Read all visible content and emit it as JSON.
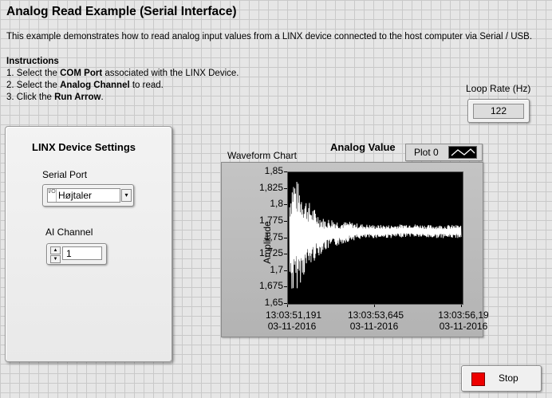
{
  "page": {
    "title": "Analog Read Example (Serial Interface)",
    "description": "This example demonstrates how to read analog input values from a LINX device connected to the host computer via Serial / USB.",
    "instructions_heading": "Instructions",
    "instructions": [
      {
        "prefix": "1. Select the ",
        "bold": "COM Port",
        "suffix": " associated with the LINX Device."
      },
      {
        "prefix": "2. Select the ",
        "bold": "Analog Channel",
        "suffix": " to read."
      },
      {
        "prefix": "3. Click the ",
        "bold": "Run Arrow",
        "suffix": "."
      }
    ]
  },
  "loop_rate": {
    "label": "Loop Rate (Hz)",
    "value": "122"
  },
  "linx_panel": {
    "title": "LINX Device Settings",
    "serial_port_label": "Serial Port",
    "serial_port_value": "Højtaler",
    "serial_port_tag": "I/O",
    "ai_channel_label": "AI Channel",
    "ai_channel_value": "1"
  },
  "chart": {
    "caption": "Waveform Chart",
    "header": "Analog Value",
    "legend": "Plot 0",
    "ylabel": "Amplitude",
    "yticks": [
      "1,85",
      "1,825",
      "1,8",
      "1,775",
      "1,75",
      "1,725",
      "1,7",
      "1,675",
      "1,65"
    ],
    "xticks": [
      {
        "time": "13:03:51,191",
        "date": "03-11-2016"
      },
      {
        "time": "13:03:53,645",
        "date": "03-11-2016"
      },
      {
        "time": "13:03:56,19",
        "date": "03-11-2016"
      }
    ]
  },
  "chart_data": {
    "type": "line",
    "title": "Analog Value",
    "ylabel": "Amplitude",
    "ylim": [
      1.65,
      1.85
    ],
    "x_range": [
      "13:03:51,191",
      "13:03:56,19"
    ],
    "series": [
      {
        "name": "Plot 0",
        "color": "#ffffff",
        "description_points": {
          "t_fraction": [
            0,
            0.02,
            0.04,
            0.06,
            0.08,
            0.1,
            0.13,
            0.16,
            0.2,
            0.25,
            0.3,
            0.35,
            0.4,
            0.5,
            0.6,
            0.7,
            0.8,
            0.9,
            1.0
          ],
          "upper": [
            1.82,
            1.85,
            1.84,
            1.83,
            1.82,
            1.81,
            1.8,
            1.79,
            1.78,
            1.78,
            1.775,
            1.775,
            1.772,
            1.77,
            1.77,
            1.772,
            1.77,
            1.77,
            1.77
          ],
          "lower": [
            1.68,
            1.66,
            1.67,
            1.68,
            1.69,
            1.7,
            1.71,
            1.72,
            1.73,
            1.735,
            1.74,
            1.745,
            1.748,
            1.75,
            1.75,
            1.752,
            1.75,
            1.75,
            1.75
          ]
        }
      }
    ]
  },
  "stop": {
    "label": "Stop",
    "color": "#ee0000"
  }
}
